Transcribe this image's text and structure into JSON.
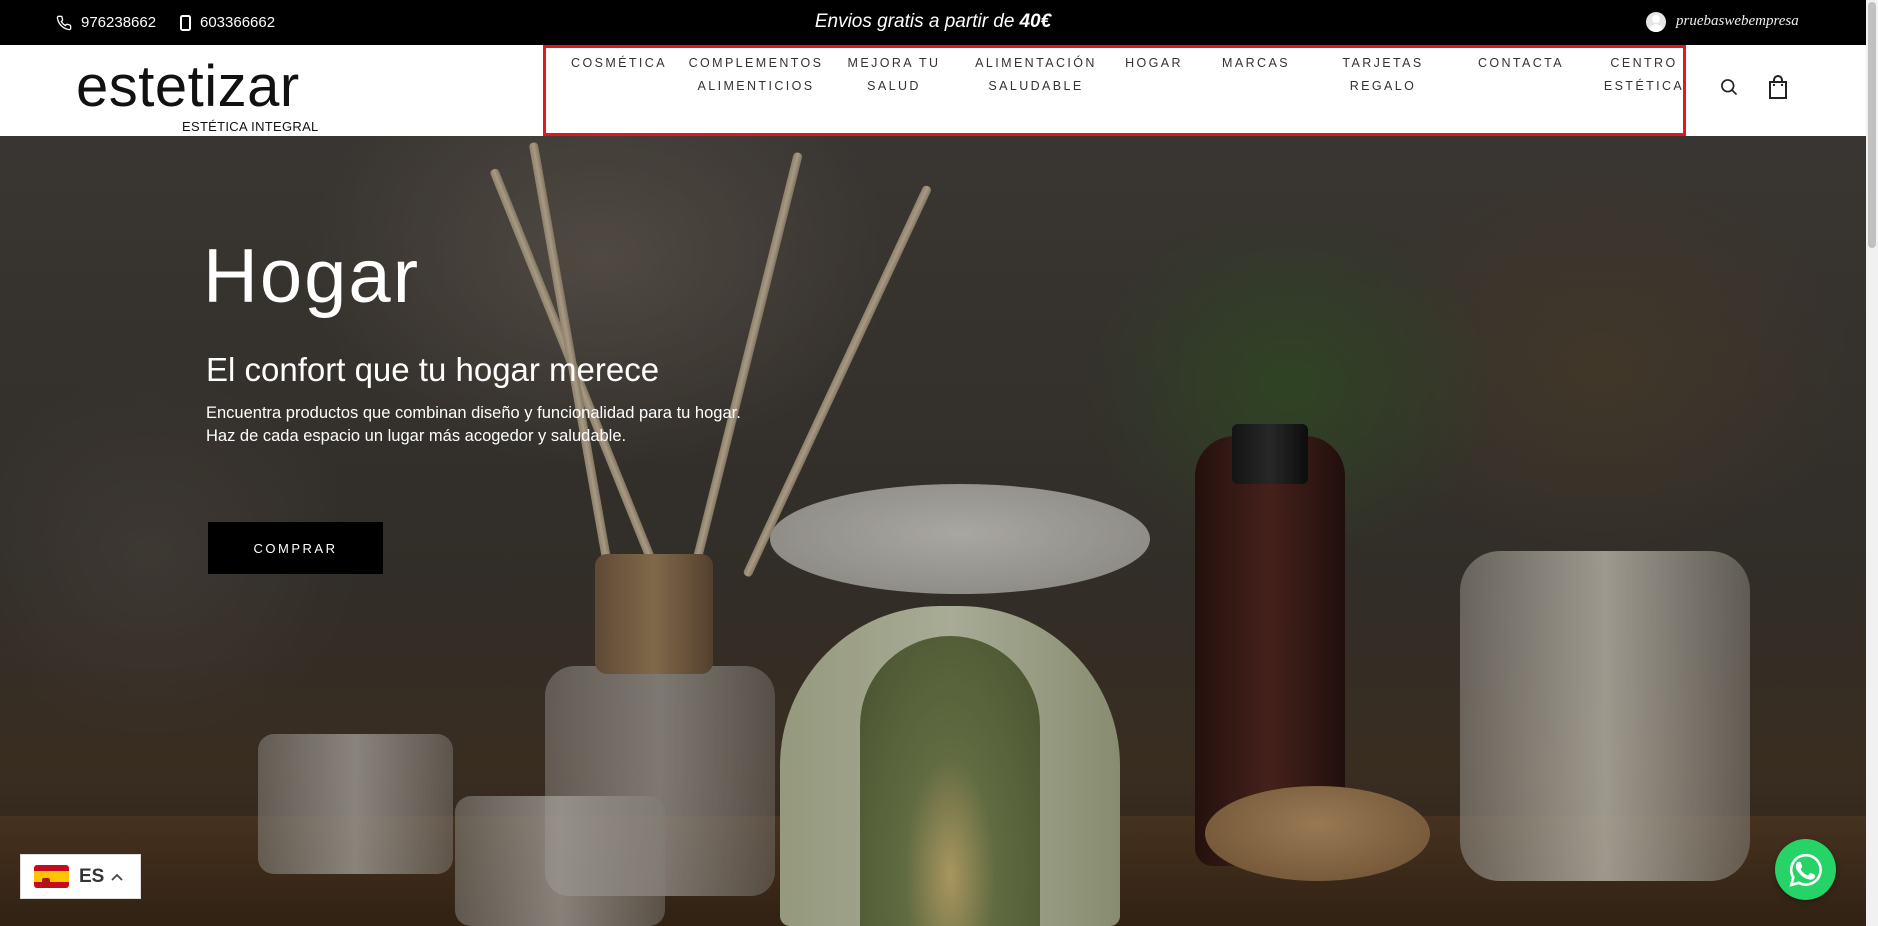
{
  "topbar": {
    "phone": "976238662",
    "mobile": "603366662",
    "promo_text": "Envios gratis a partir de",
    "promo_amount": "40€",
    "username": "pruebaswebempresa"
  },
  "brand": {
    "name": "estetizar",
    "tagline": "ESTÉTICA INTEGRAL"
  },
  "nav": {
    "items": [
      {
        "line1": "COSMÉTICA",
        "line2": ""
      },
      {
        "line1": "COMPLEMENTOS",
        "line2": "ALIMENTICIOS"
      },
      {
        "line1": "MEJORA TU",
        "line2": "SALUD"
      },
      {
        "line1": "ALIMENTACIÓN",
        "line2": "SALUDABLE"
      },
      {
        "line1": "HOGAR",
        "line2": ""
      },
      {
        "line1": "MARCAS",
        "line2": ""
      },
      {
        "line1": "TARJETAS",
        "line2": "REGALO"
      },
      {
        "line1": "CONTACTA",
        "line2": ""
      },
      {
        "line1": "CENTRO",
        "line2": "ESTÉTICA"
      }
    ],
    "highlight_color": "#e8151f"
  },
  "hero": {
    "title": "Hogar",
    "subtitle": "El confort que tu hogar merece",
    "desc_line1": "Encuentra productos que combinan diseño y funcionalidad para tu hogar.",
    "desc_line2": "Haz de cada espacio un lugar más acogedor y saludable.",
    "button_label": "COMPRAR"
  },
  "language": {
    "code": "ES",
    "flag": "spain-flag-icon"
  },
  "icons": {
    "phone": "phone-icon",
    "mobile": "mobile-icon",
    "user": "user-avatar-icon",
    "search": "search-icon",
    "cart": "shopping-bag-icon",
    "whatsapp": "whatsapp-icon",
    "chevron": "chevron-up-icon"
  },
  "colors": {
    "topbar_bg": "#000000",
    "whatsapp_green": "#25d366"
  }
}
